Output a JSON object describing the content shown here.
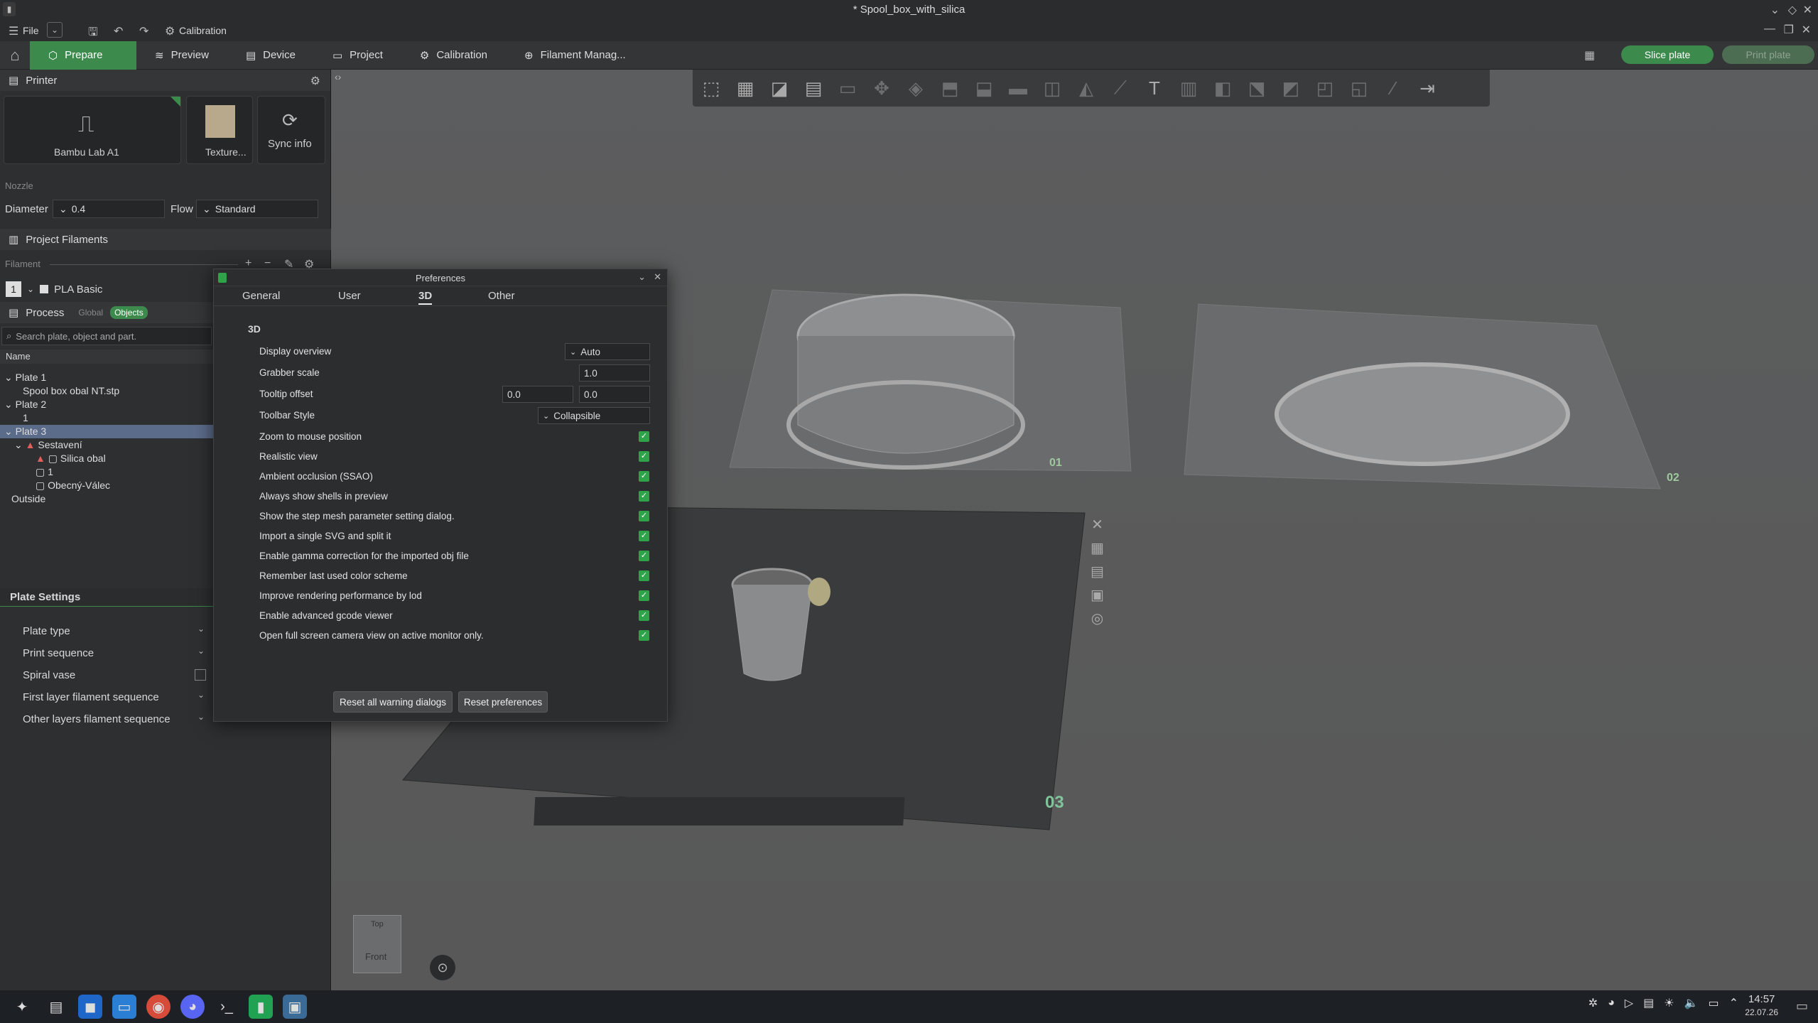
{
  "window": {
    "title": "* Spool_box_with_silica"
  },
  "menubar": {
    "file": "File",
    "calibration": "Calibration"
  },
  "tabs": [
    {
      "label": "Prepare",
      "active": true
    },
    {
      "label": "Preview"
    },
    {
      "label": "Device"
    },
    {
      "label": "Project"
    },
    {
      "label": "Calibration"
    },
    {
      "label": "Filament Manag..."
    }
  ],
  "actions": {
    "slice": "Slice plate",
    "print": "Print plate"
  },
  "printer": {
    "header": "Printer",
    "model": "Bambu Lab A1",
    "plate": "Texture...",
    "sync": "Sync info",
    "nozzle_label": "Nozzle",
    "diameter_label": "Diameter",
    "diameter_value": "0.4",
    "flow_label": "Flow",
    "flow_value": "Standard"
  },
  "filaments": {
    "header": "Project Filaments",
    "label": "Filament",
    "items": [
      {
        "index": "1",
        "name": "PLA Basic"
      }
    ]
  },
  "process": {
    "header": "Process",
    "global": "Global",
    "objects": "Objects",
    "search_placeholder": "Search plate, object and part."
  },
  "objects_tree": {
    "column": "Name",
    "rows": [
      "Plate 1",
      "Spool box obal NT.stp",
      "Plate 2",
      "1",
      "Plate 3",
      "Sestavení",
      "Silica obal",
      "1",
      "Obecný-Válec",
      "Outside"
    ]
  },
  "plate_settings": {
    "header": "Plate Settings",
    "rows": [
      "Plate type",
      "Print sequence",
      "Spiral vase",
      "First layer filament sequence",
      "Other layers filament sequence"
    ]
  },
  "preferences": {
    "title": "Preferences",
    "tabs": [
      "General",
      "User",
      "3D",
      "Other"
    ],
    "active_tab": "3D",
    "section": "3D",
    "display_overview_label": "Display overview",
    "display_overview_value": "Auto",
    "grabber_scale_label": "Grabber scale",
    "grabber_scale_value": "1.0",
    "tooltip_offset_label": "Tooltip offset",
    "tooltip_offset_x": "0.0",
    "tooltip_offset_y": "0.0",
    "toolbar_style_label": "Toolbar Style",
    "toolbar_style_value": "Collapsible",
    "checkboxes": [
      "Zoom to mouse position",
      "Realistic view",
      "Ambient occlusion (SSAO)",
      "Always show shells in preview",
      "Show the step mesh parameter setting dialog.",
      "Import a single SVG and split it",
      "Enable gamma correction for the imported obj file",
      "Remember last used color scheme",
      "Improve rendering performance by lod",
      "Enable advanced gcode viewer",
      "Open full screen camera view on active monitor only."
    ],
    "reset_warnings": "Reset all warning dialogs",
    "reset_prefs": "Reset preferences"
  },
  "plates": {
    "p1": "01",
    "p2": "02",
    "p3": "03"
  },
  "viewcube": {
    "top": "Top",
    "front": "Front"
  },
  "clock": {
    "time": "14:57",
    "date": "22.07.26"
  }
}
